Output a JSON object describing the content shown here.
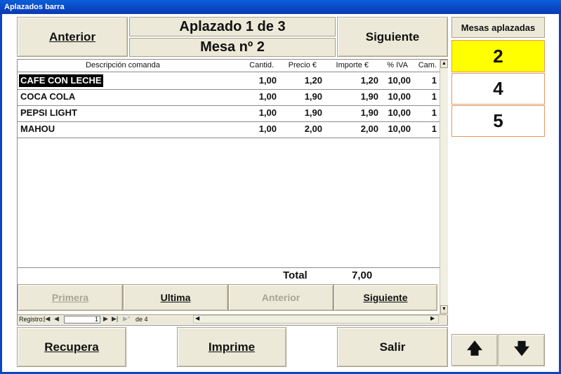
{
  "window": {
    "title": "Aplazados barra"
  },
  "header": {
    "prev_label": "Anterior",
    "next_label": "Siguiente",
    "aplazado_text": "Aplazado 1 de 3",
    "mesa_text": "Mesa nº 2"
  },
  "grid": {
    "columns": [
      "Descripción comanda",
      "Cantid.",
      "Precio €",
      "Importe €",
      "% IVA",
      "Cam."
    ],
    "rows": [
      {
        "descripcion": "CAFE CON LECHE",
        "cantidad": "1,00",
        "precio": "1,20",
        "importe": "1,20",
        "iva": "10,00",
        "cam": "1"
      },
      {
        "descripcion": "COCA COLA",
        "cantidad": "1,00",
        "precio": "1,90",
        "importe": "1,90",
        "iva": "10,00",
        "cam": "1"
      },
      {
        "descripcion": "PEPSI LIGHT",
        "cantidad": "1,00",
        "precio": "1,90",
        "importe": "1,90",
        "iva": "10,00",
        "cam": "1"
      },
      {
        "descripcion": "MAHOU",
        "cantidad": "1,00",
        "precio": "2,00",
        "importe": "2,00",
        "iva": "10,00",
        "cam": "1"
      }
    ],
    "total_label": "Total",
    "total_value": "7,00"
  },
  "pager": {
    "first_label": "Primera",
    "last_label": "Ultima",
    "prev_label": "Anterior",
    "next_label": "Siguiente"
  },
  "record_nav": {
    "label": "Registro:",
    "current": "1",
    "of_text": "de 4"
  },
  "bottom": {
    "recupera_label": "Recupera",
    "imprime_label": "Imprime",
    "salir_label": "Salir"
  },
  "sidebar": {
    "title": "Mesas aplazadas",
    "mesas": [
      "2",
      "4",
      "5"
    ],
    "selected_color": "#ffff00"
  }
}
